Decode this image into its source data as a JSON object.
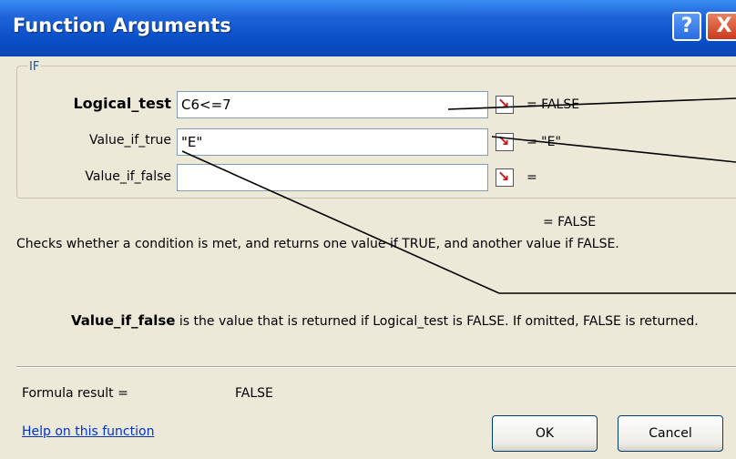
{
  "dialog": {
    "title": "Function Arguments",
    "help_glyph": "?",
    "close_glyph": "X",
    "group_label": "IF"
  },
  "arguments": [
    {
      "label": "Logical_test",
      "value": "C6<=7",
      "result": "= FALSE",
      "bold": true
    },
    {
      "label": "Value_if_true",
      "value": "\"E\"",
      "result": "= \"E\"",
      "bold": false
    },
    {
      "label": "Value_if_false",
      "value": "",
      "result": "=",
      "bold": false
    }
  ],
  "function_result": "= FALSE",
  "description": "Checks whether a condition is met, and returns one value if TRUE, and another value if FALSE.",
  "argument_help": {
    "name": "Value_if_false",
    "text": " is the value that is returned if Logical_test is FALSE. If omitted, FALSE is returned."
  },
  "formula": {
    "label": "Formula result =",
    "value": "FALSE"
  },
  "help_link": "Help on this function",
  "buttons": {
    "ok": "OK",
    "cancel": "Cancel"
  },
  "colors": {
    "titlebar": "#0a4ec8",
    "dialog_bg": "#ece9d8",
    "link": "#0033cc",
    "collapse_arrow": "#c41818"
  },
  "icons": {
    "collapse": "collapse-dialog-icon",
    "help": "help-icon",
    "close": "close-icon"
  }
}
